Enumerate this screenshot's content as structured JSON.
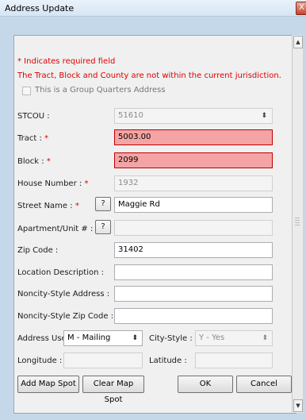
{
  "window": {
    "title": "Address Update",
    "close_glyph": "X"
  },
  "notes": {
    "required": "* Indicates required field",
    "jurisdiction_warning": "The Tract, Block and County are not within the current jurisdiction."
  },
  "group_quarters": {
    "label": "This is a Group Quarters Address",
    "checked": false
  },
  "fields": {
    "stcou": {
      "label": "STCOU :",
      "value": "51610"
    },
    "tract": {
      "label": "Tract :",
      "required_mark": "*",
      "value": "5003.00"
    },
    "block": {
      "label": "Block :",
      "required_mark": "*",
      "value": "2099"
    },
    "house_number": {
      "label": "House Number :",
      "required_mark": "*",
      "value": "1932"
    },
    "street_name": {
      "label": "Street Name :",
      "required_mark": "*",
      "value": "Maggie Rd",
      "help": "?"
    },
    "apartment": {
      "label": "Apartment/Unit # :",
      "value": "",
      "help": "?"
    },
    "zip": {
      "label": "Zip Code :",
      "value": "31402"
    },
    "location_description": {
      "label": "Location Description :",
      "value": ""
    },
    "noncity_address": {
      "label": "Noncity-Style Address :",
      "value": ""
    },
    "noncity_zip": {
      "label": "Noncity-Style Zip Code :",
      "value": ""
    },
    "address_use": {
      "label": "Address Use:",
      "value": "M - Mailing"
    },
    "city_style": {
      "label": "City-Style :",
      "value": "Y - Yes"
    },
    "longitude": {
      "label": "Longitude :",
      "value": ""
    },
    "latitude": {
      "label": "Latitude :",
      "value": ""
    }
  },
  "buttons": {
    "add_map_spot": "Add Map Spot",
    "clear_map_spot": "Clear Map Spot",
    "ok": "OK",
    "cancel": "Cancel"
  },
  "icons": {
    "spinner": "updown-arrows-icon",
    "dropdown": "updown-arrows-icon",
    "scroll_up": "up-arrow-icon",
    "scroll_down": "down-arrow-icon"
  },
  "colors": {
    "required": "#e00000",
    "error_fill": "#f4a4a4",
    "error_border": "#c00000"
  }
}
